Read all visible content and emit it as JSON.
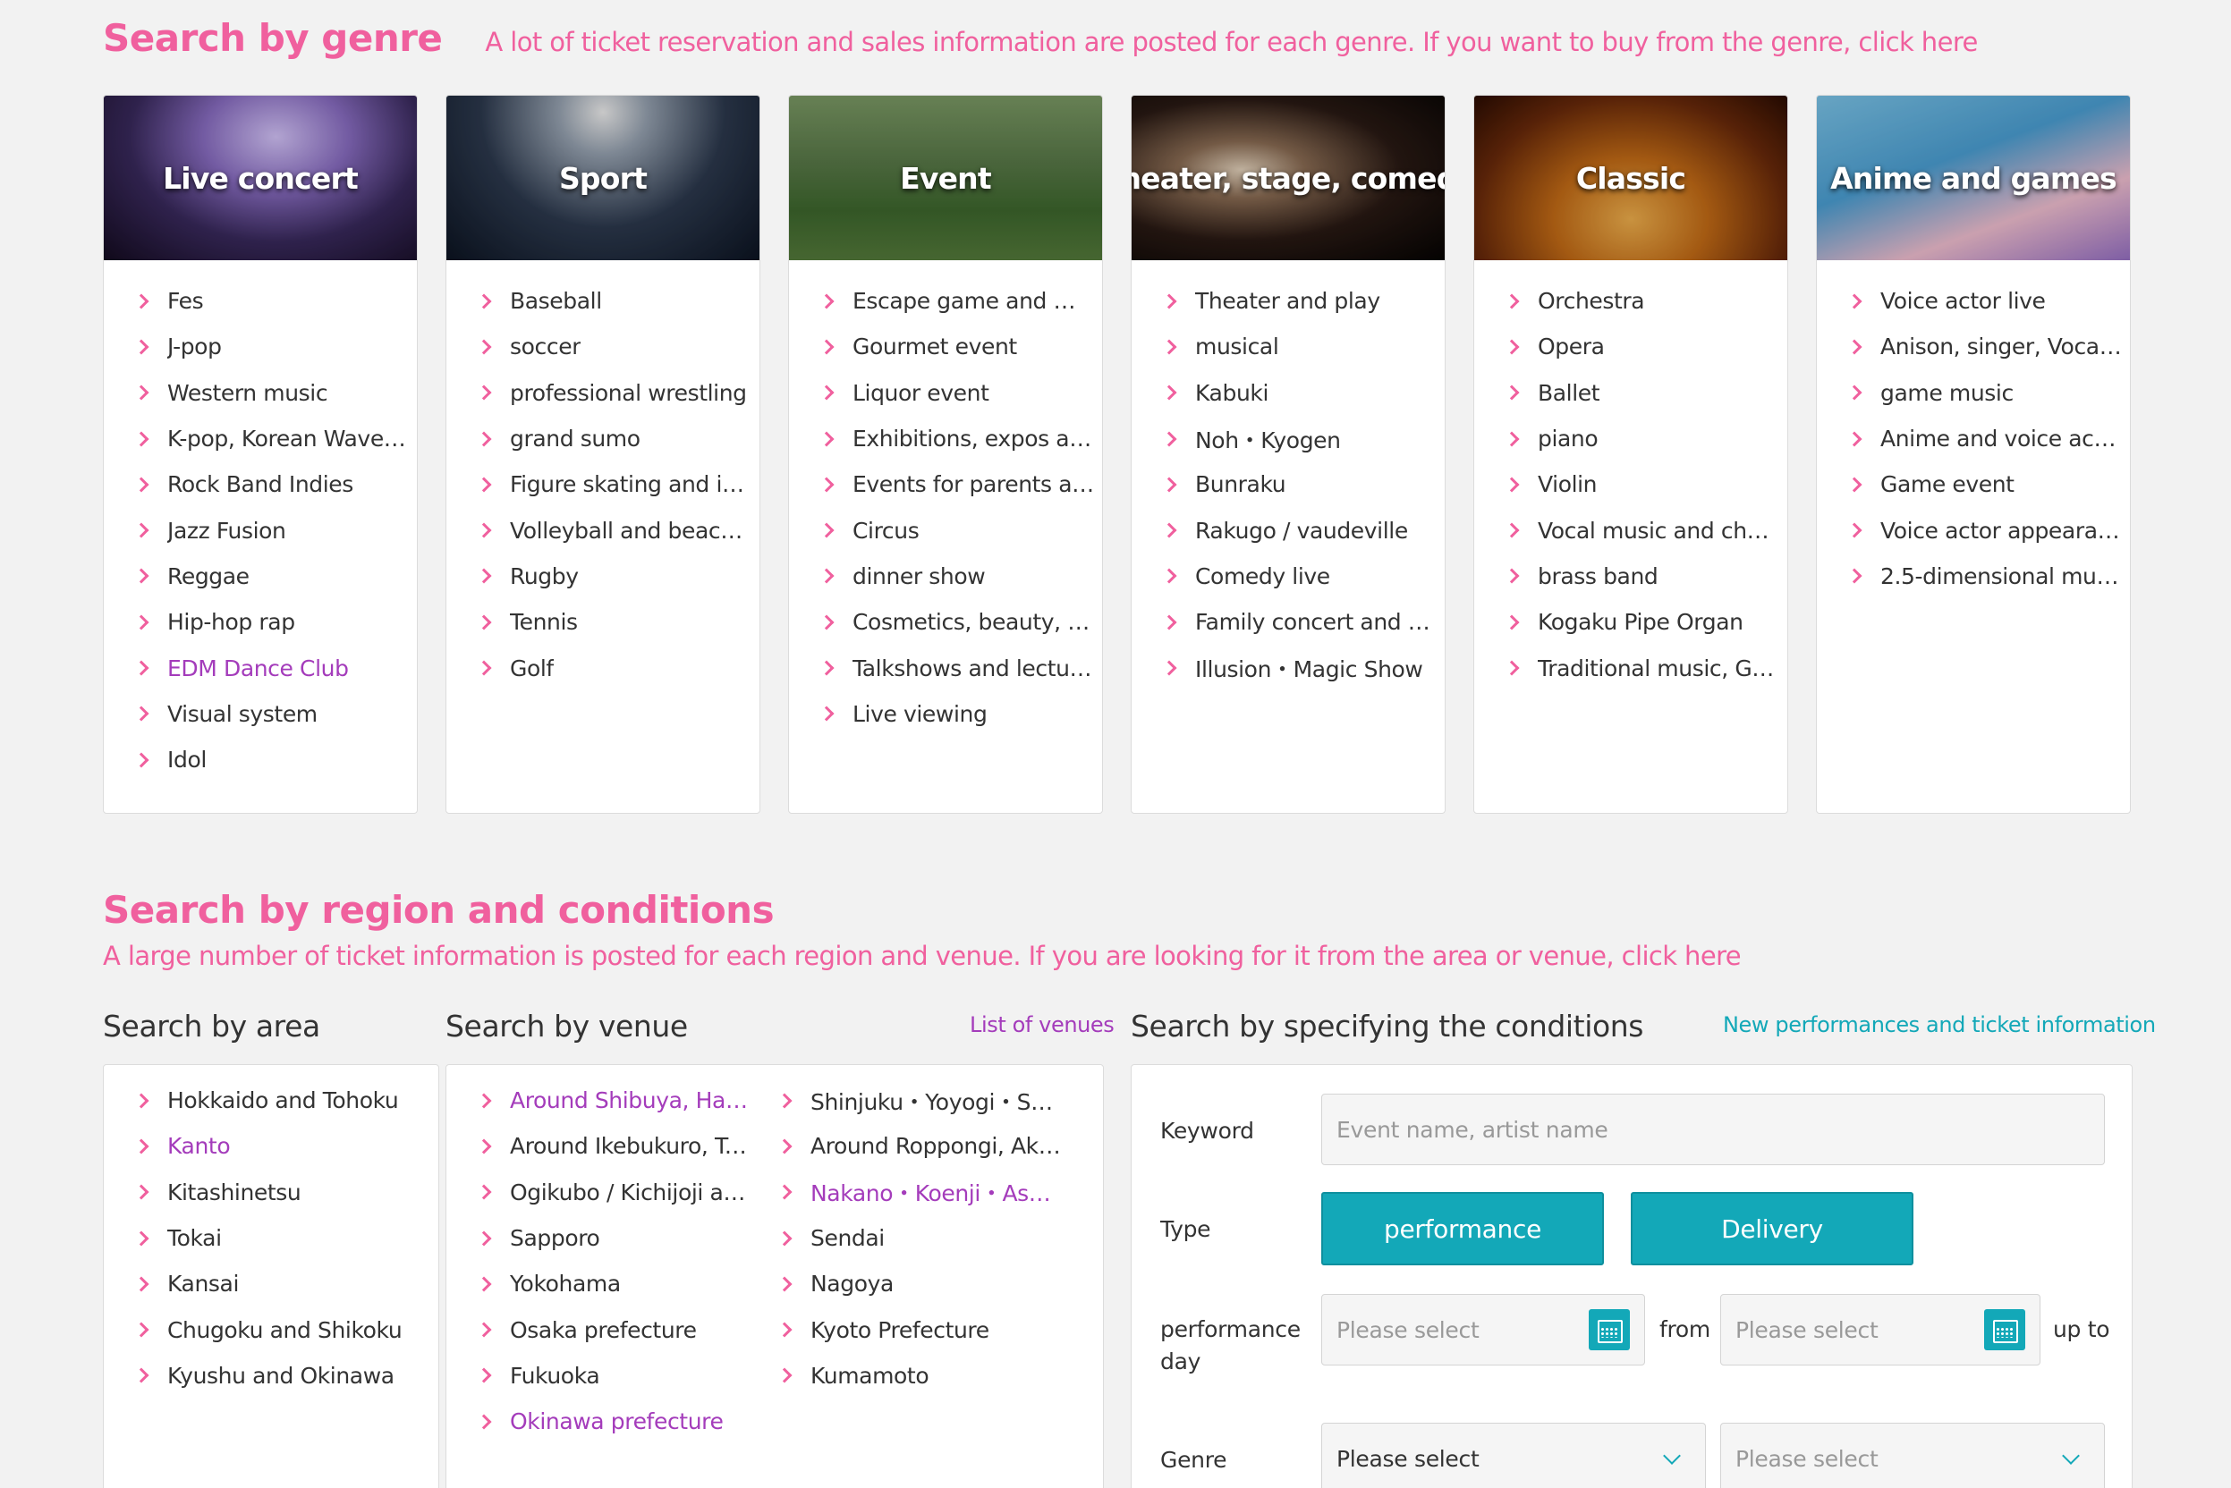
{
  "genre_section": {
    "title": "Search by genre",
    "description": "A lot of ticket reservation and sales information are posted for each genre. If you want to buy from the genre, click here"
  },
  "genres": [
    {
      "title": "Live concert",
      "items": [
        "Fes",
        "J-pop",
        "Western music",
        "K-pop, Korean Wave…",
        "Rock Band Indies",
        "Jazz Fusion",
        "Reggae",
        "Hip-hop rap",
        "EDM Dance Club",
        "Visual system",
        "Idol"
      ]
    },
    {
      "title": "Sport",
      "items": [
        "Baseball",
        "soccer",
        "professional wrestling",
        "grand sumo",
        "Figure skating and i…",
        "Volleyball and beac…",
        "Rugby",
        "Tennis",
        "Golf"
      ]
    },
    {
      "title": "Event",
      "items": [
        "Escape game and m…",
        "Gourmet event",
        "Liquor event",
        "Exhibitions, expos a…",
        "Events for parents a…",
        "Circus",
        "dinner show",
        "Cosmetics, beauty, f…",
        "Talkshows and lectu…",
        "Live viewing"
      ]
    },
    {
      "title": "Theater, stage, comedy",
      "items": [
        "Theater and play",
        "musical",
        "Kabuki",
        "Noh・Kyogen",
        "Bunraku",
        "Rakugo / vaudeville",
        "Comedy live",
        "Family concert and …",
        "Illusion・Magic Show"
      ]
    },
    {
      "title": "Classic",
      "items": [
        "Orchestra",
        "Opera",
        "Ballet",
        "piano",
        "Violin",
        "Vocal music and cho…",
        "brass band",
        "Kogaku Pipe Organ",
        "Traditional music, G…"
      ]
    },
    {
      "title": "Anime and games",
      "items": [
        "Voice actor live",
        "Anison, singer, Vocal…",
        "game music",
        "Anime and voice act…",
        "Game event",
        "Voice actor appeara…",
        "2.5-dimensional mu…"
      ]
    }
  ],
  "region_section": {
    "title": "Search by region and conditions",
    "description": "A large number of ticket information is posted for each region and venue. If you are looking for it from the area or venue, click here"
  },
  "area": {
    "heading": "Search by area",
    "items": [
      "Hokkaido and Tohoku",
      "Kanto",
      "Kitashinetsu",
      "Tokai",
      "Kansai",
      "Chugoku and Shikoku",
      "Kyushu and Okinawa"
    ]
  },
  "venue": {
    "heading": "Search by venue",
    "link": "List of venues",
    "col1": [
      "Around Shibuya, Hara…",
      "Around Ikebukuro, Ta…",
      "Ogikubo / Kichijoji area",
      "Sapporo",
      "Yokohama",
      "Osaka prefecture",
      "Fukuoka",
      "Okinawa prefecture"
    ],
    "col2": [
      "Shinjuku・Yoyogi・S…",
      "Around Roppongi, Ak…",
      "Nakano・Koenji・As…",
      "Sendai",
      "Nagoya",
      "Kyoto Prefecture",
      "Kumamoto"
    ]
  },
  "conditions": {
    "heading": "Search by specifying the conditions",
    "link": "New performances and ticket information",
    "keyword_label": "Keyword",
    "keyword_placeholder": "Event name, artist name",
    "type_label": "Type",
    "type_performance": "performance",
    "type_delivery": "Delivery",
    "day_label_1": "performance",
    "day_label_2": "day",
    "date_from_placeholder": "Please select",
    "from_text": "from",
    "date_to_placeholder": "Please select",
    "up_to_text": "up to",
    "genre_label": "Genre",
    "genre_select_value": "Please select",
    "subgenre_select_value": "Please select"
  },
  "colors": {
    "accent_pink": "#f0609e",
    "visited_purple": "#a43cbb",
    "teal": "#13a8b8"
  }
}
